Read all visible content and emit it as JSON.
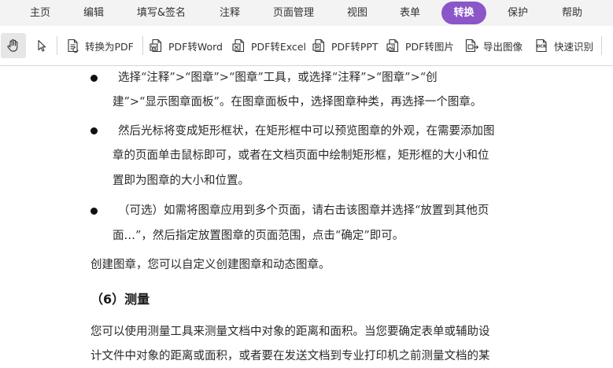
{
  "menu": {
    "items": [
      "主页",
      "编辑",
      "填写&签名",
      "注释",
      "页面管理",
      "视图",
      "表单",
      "转换",
      "保护",
      "帮助"
    ],
    "active": "转换",
    "accent_color": "#8a56c8"
  },
  "toolbar": {
    "hand_icon": "hand-pan-icon",
    "select_icon": "arrow-select-icon",
    "convert_to_pdf": "转换为PDF",
    "pdf_to_word": "PDF转Word",
    "pdf_to_excel": "PDF转Excel",
    "pdf_to_ppt": "PDF转PPT",
    "pdf_to_image": "PDF转图片",
    "export_image": "导出图像",
    "ocr": "快速识别",
    "ocr_icon_text": "OCR"
  },
  "document": {
    "bullet1": {
      "line1": "选择“注释”>“图章”>“图章”工具，或选择“注释”>“图章”>“创",
      "line2": "建”>“显示图章面板”。在图章面板中，选择图章种类，再选择一个图章。"
    },
    "bullet2": {
      "line1": "然后光标将变成矩形框状，在矩形框中可以预览图章的外观，在需要添加图",
      "line2": "章的页面单击鼠标即可，或者在文档页面中绘制矩形框，矩形框的大小和位",
      "line3": "置即为图章的大小和位置。"
    },
    "bullet3": {
      "line1": "（可选）如需将图章应用到多个页面，请右击该图章并选择“放置到其他页",
      "line2": "面…”，然后指定放置图章的页面范围，点击“确定”即可。"
    },
    "paragraph1": "创建图章，您可以自定义创建图章和动态图章。",
    "section_heading": "（6）测量",
    "paragraph2": {
      "line1": "您可以使用测量工具来测量文档中对象的距离和面积。当您要确定表单或辅助设",
      "line2": "计文件中对象的距离或面积，或者要在发送文档到专业打印机之前测量文档的某"
    }
  }
}
